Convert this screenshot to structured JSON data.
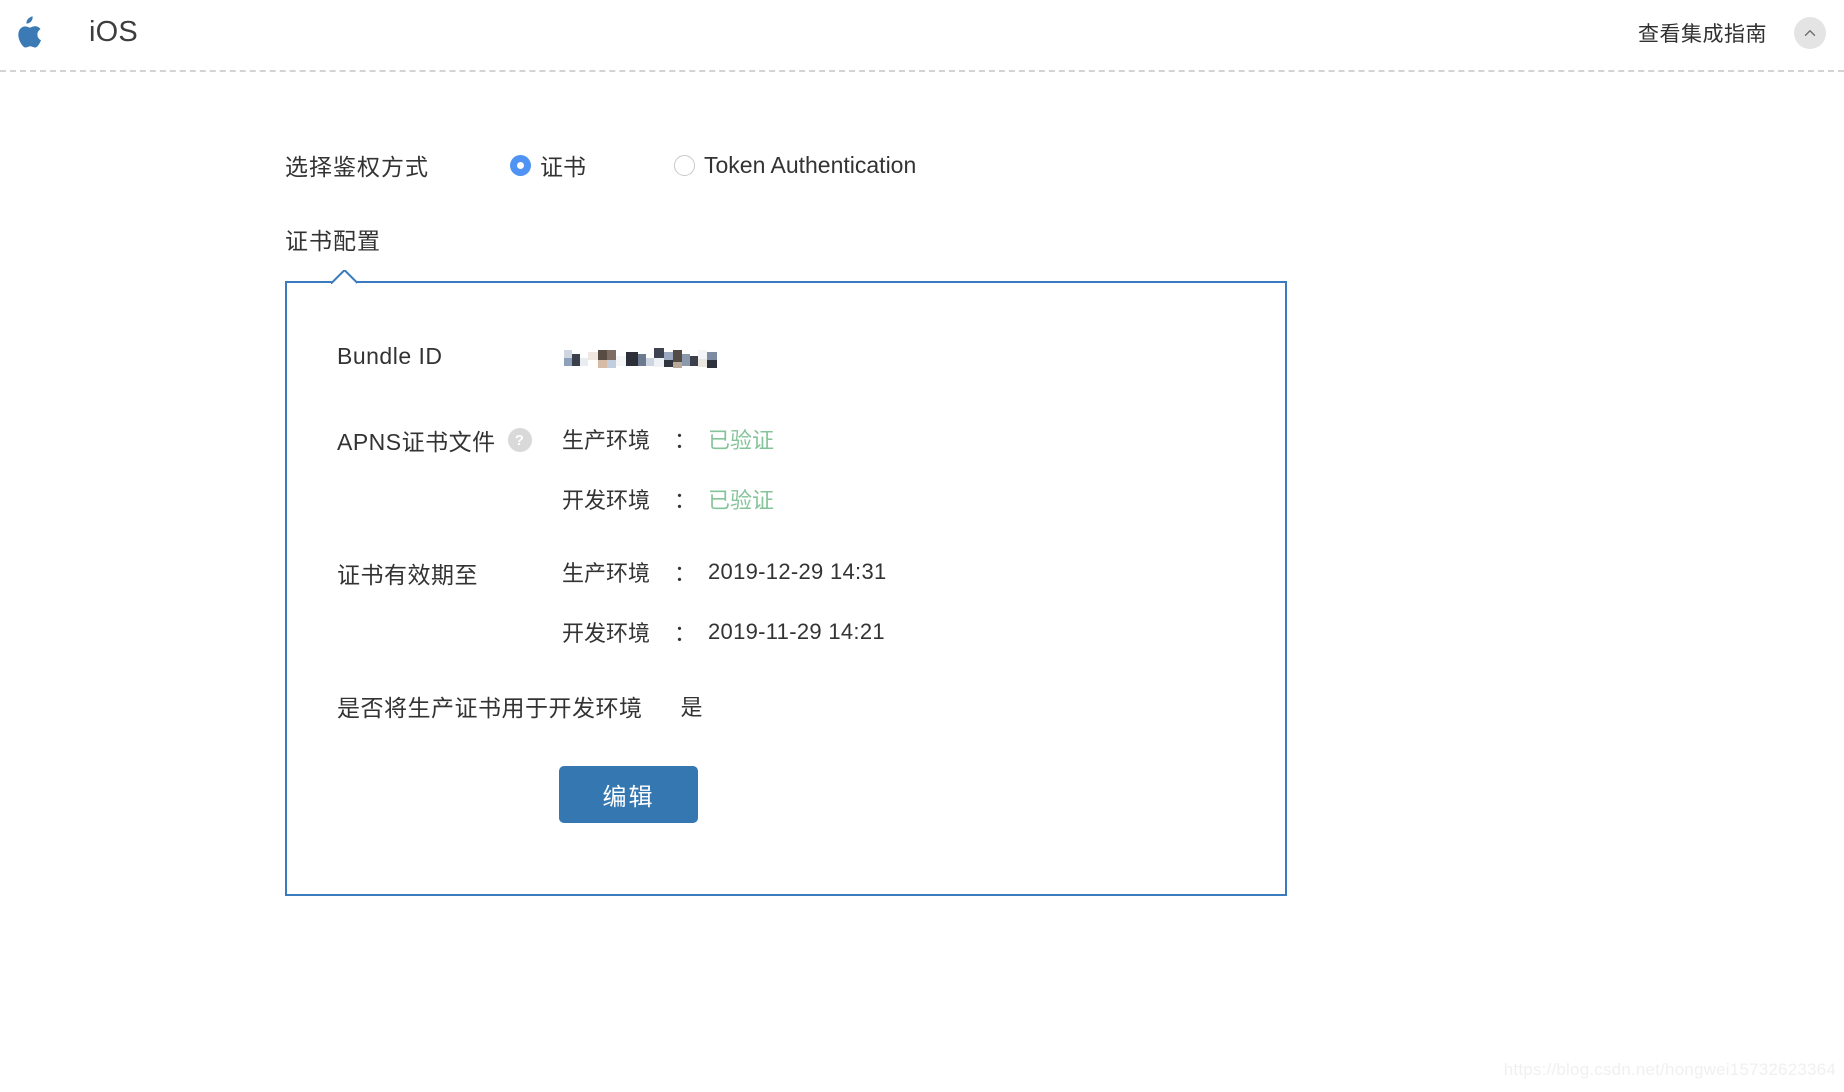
{
  "header": {
    "apple_icon": "apple-logo-icon",
    "platform": "iOS",
    "guide_link": "查看集成指南",
    "collapse_icon": "chevron-up-icon"
  },
  "auth": {
    "label": "选择鉴权方式",
    "options": [
      {
        "label": "证书",
        "selected": true
      },
      {
        "label": "Token Authentication",
        "selected": false
      }
    ]
  },
  "section": {
    "title": "证书配置"
  },
  "card": {
    "bundle": {
      "label": "Bundle ID",
      "value_redacted": "mosaic-redacted"
    },
    "apns": {
      "label": "APNS证书文件",
      "help_icon": "question-mark-icon",
      "help_glyph": "?",
      "rows": [
        {
          "env": "生产环境",
          "colon": "：",
          "status": "已验证"
        },
        {
          "env": "开发环境",
          "colon": "：",
          "status": "已验证"
        }
      ]
    },
    "validity": {
      "label": "证书有效期至",
      "rows": [
        {
          "env": "生产环境",
          "colon": "：",
          "date": "2019-12-29 14:31"
        },
        {
          "env": "开发环境",
          "colon": "：",
          "date": "2019-11-29 14:21"
        }
      ]
    },
    "prod_for_dev": {
      "label": "是否将生产证书用于开发环境",
      "value": "是"
    },
    "edit_button": "编辑"
  },
  "colors": {
    "accent_blue": "#3a7bbf",
    "radio_blue": "#4f93f5",
    "button_blue": "#3577b0",
    "verified_green": "#85c49a",
    "apple_blue": "#3b7ab5"
  },
  "watermark": "https://blog.csdn.net/hongwei15732623364"
}
